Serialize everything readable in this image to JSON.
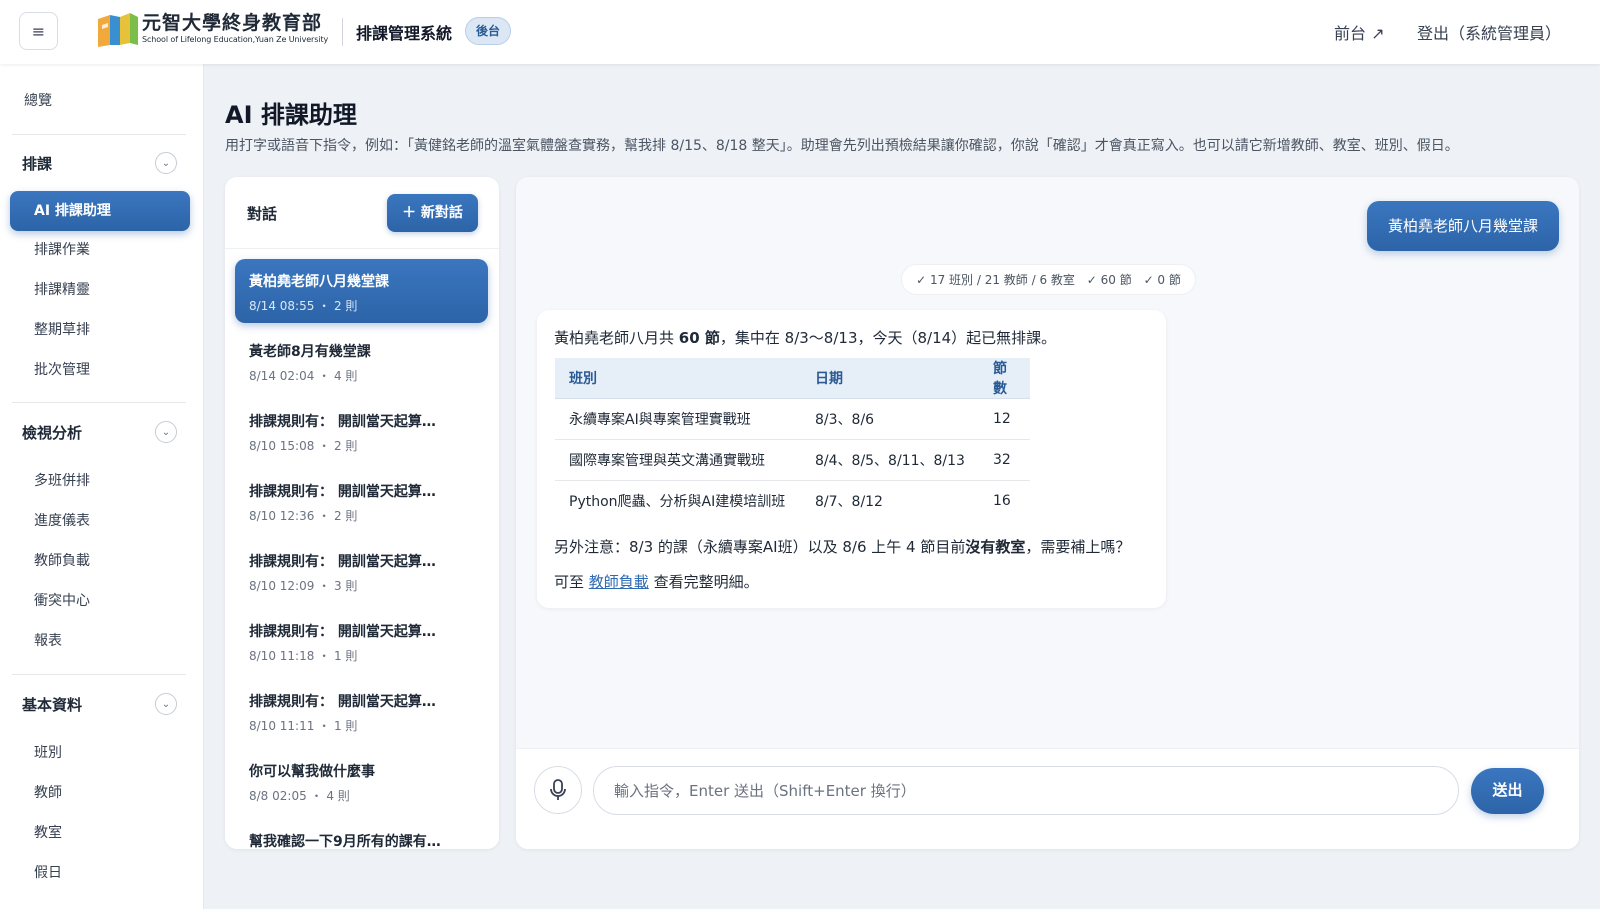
{
  "header": {
    "menu_icon": "hamburger-icon",
    "logo_icon": "book-logo-icon",
    "brand_zh": "元智大學終身教育部",
    "brand_en": "School of Lifelong Education,Yuan Ze University",
    "system_title": "排課管理系統",
    "badge": "後台",
    "front_link": "前台 ↗",
    "logout": "登出（系統管理員）"
  },
  "sidebar": {
    "overview": "總覽",
    "sections": [
      {
        "title": "排課",
        "items": [
          "AI 排課助理",
          "排課作業",
          "排課精靈",
          "整期草排",
          "批次管理"
        ],
        "active_index": 0
      },
      {
        "title": "檢視分析",
        "items": [
          "多班併排",
          "進度儀表",
          "教師負載",
          "衝突中心",
          "報表"
        ]
      },
      {
        "title": "基本資料",
        "items": [
          "班別",
          "教師",
          "教室",
          "假日"
        ]
      }
    ]
  },
  "page": {
    "title": "AI 排課助理",
    "description": "用打字或語音下指令，例如：「黃健銘老師的溫室氣體盤查實務，幫我排 8/15、8/18 整天」。助理會先列出預檢結果讓你確認，你說「確認」才會真正寫入。也可以請它新增教師、教室、班別、假日。"
  },
  "conversations": {
    "title": "對話",
    "new_button": "＋ 新對話",
    "items": [
      {
        "title": "黃柏堯老師八月幾堂課",
        "meta": "8/14 08:55 ・ 2 則",
        "active": true
      },
      {
        "title": "黃老師8月有幾堂課",
        "meta": "8/14 02:04 ・ 4 則"
      },
      {
        "title": "排課規則有： 開訓當天起算…",
        "meta": "8/10 15:08 ・ 2 則"
      },
      {
        "title": "排課規則有： 開訓當天起算…",
        "meta": "8/10 12:36 ・ 2 則"
      },
      {
        "title": "排課規則有： 開訓當天起算…",
        "meta": "8/10 12:09 ・ 3 則"
      },
      {
        "title": "排課規則有： 開訓當天起算…",
        "meta": "8/10 11:18 ・ 1 則"
      },
      {
        "title": "排課規則有： 開訓當天起算…",
        "meta": "8/10 11:11 ・ 1 則"
      },
      {
        "title": "你可以幫我做什麼事",
        "meta": "8/8 02:05 ・ 4 則"
      },
      {
        "title": "幫我確認一下9月所有的課有…",
        "meta": ""
      }
    ]
  },
  "chat": {
    "user_message": "黃柏堯老師八月幾堂課",
    "stats": [
      "✓ 17 班別 / 21 教師 / 6 教室",
      "✓ 60 節",
      "✓ 0 節"
    ],
    "reply": {
      "line1_a": "黃柏堯老師八月共 ",
      "line1_b": "60 節",
      "line1_c": "，集中在 8/3～8/13，今天（8/14）起已無排課。",
      "table": {
        "headers": [
          "班別",
          "日期",
          "節數"
        ],
        "rows": [
          [
            "永續專案AI與專案管理實戰班",
            "8/3、8/6",
            "12"
          ],
          [
            "國際專案管理與英文溝通實戰班",
            "8/4、8/5、8/11、8/13",
            "32"
          ],
          [
            "Python爬蟲、分析與AI建模培訓班",
            "8/7、8/12",
            "16"
          ]
        ]
      },
      "line2_a": "另外注意：8/3 的課（永續專案AI班）以及 8/6 上午 4 節目前",
      "line2_b": "沒有教室",
      "line2_c": "，需要補上嗎？",
      "line3_a": "可至 ",
      "line3_link": "教師負載",
      "line3_c": " 查看完整明細。"
    },
    "input_placeholder": "輸入指令，Enter 送出（Shift+Enter 換行）",
    "input_value": "",
    "mic_icon": "microphone-icon",
    "send": "送出"
  },
  "colors": {
    "accent": "#2d64a8",
    "accent_light": "#dbe7f5",
    "link": "#2f6bb3"
  }
}
